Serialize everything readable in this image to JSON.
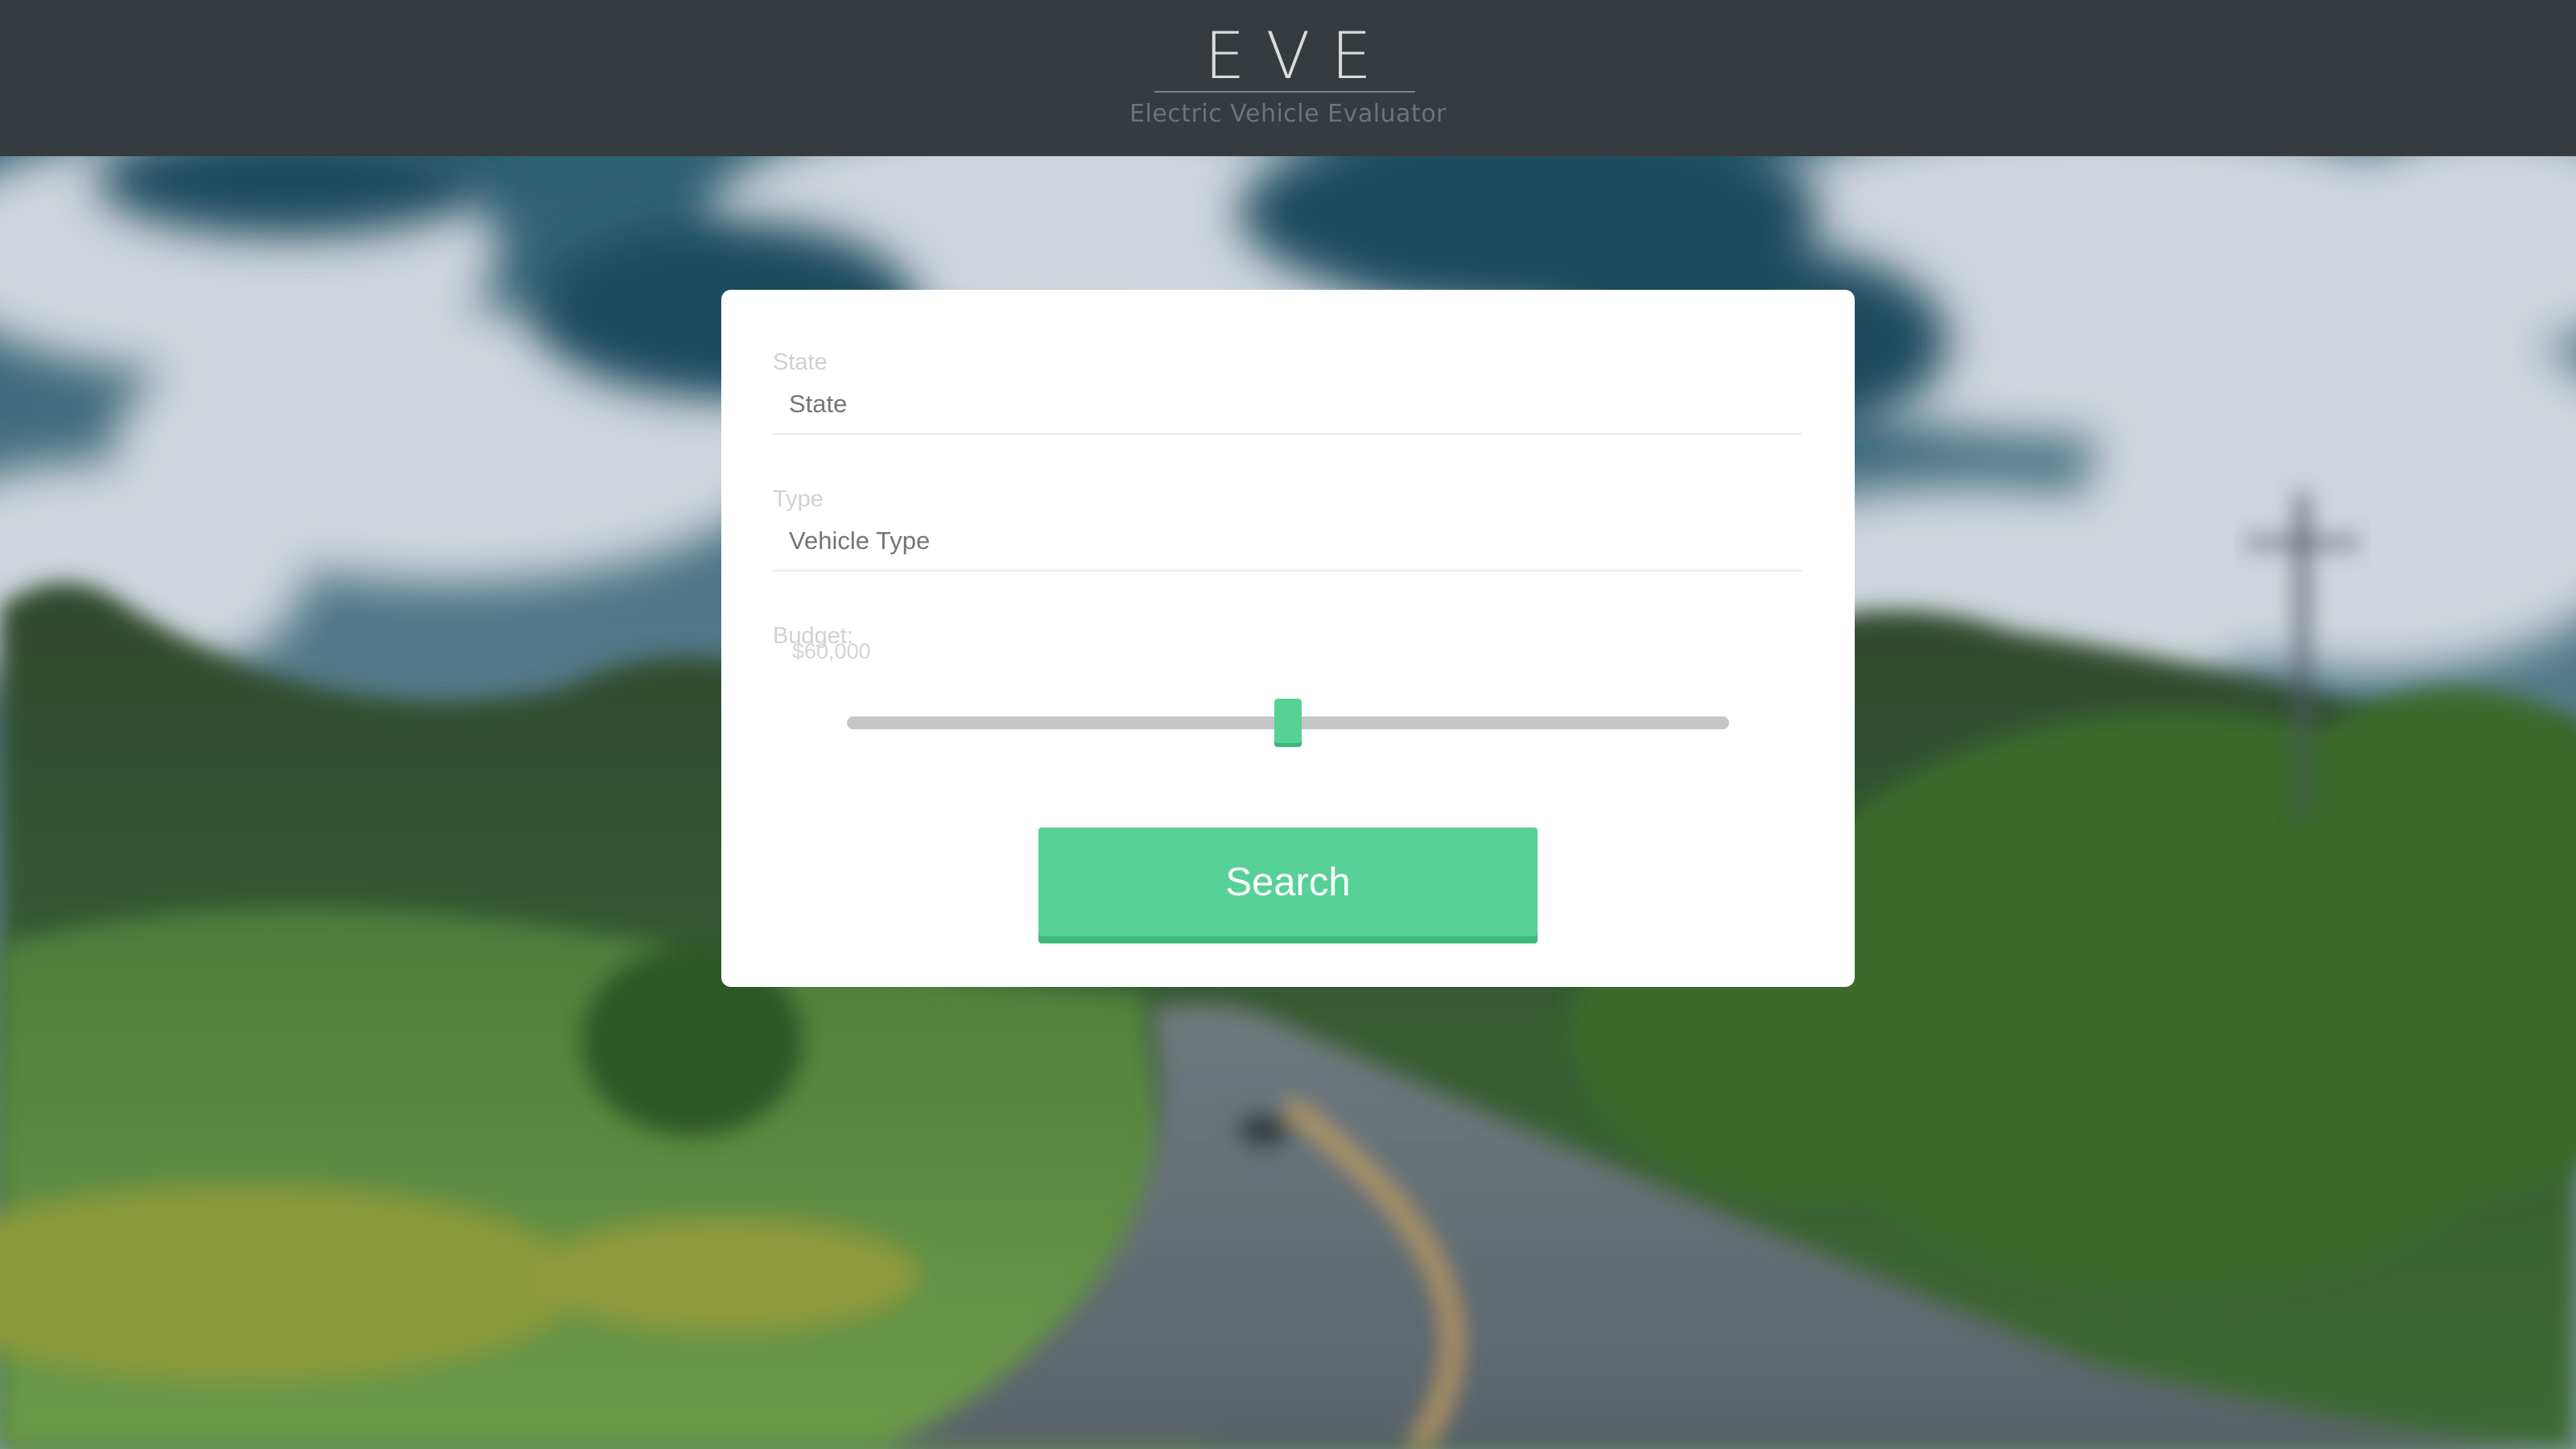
{
  "header": {
    "logo_title": "EVE",
    "logo_subtitle": "Electric Vehicle Evaluator"
  },
  "form": {
    "state": {
      "label": "State",
      "placeholder": "State"
    },
    "type": {
      "label": "Type",
      "placeholder": "Vehicle Type"
    },
    "budget": {
      "label": "Budget:",
      "value_text": "$60,000",
      "slider_fraction": 0.5
    },
    "search_label": "Search"
  },
  "colors": {
    "header_bg": "#353b3e",
    "accent": "#58d197",
    "accent_dark": "#40b97c",
    "card_bg": "#ffffff",
    "track": "#c6c6c6"
  },
  "background_image": "blurred-road-landscape"
}
